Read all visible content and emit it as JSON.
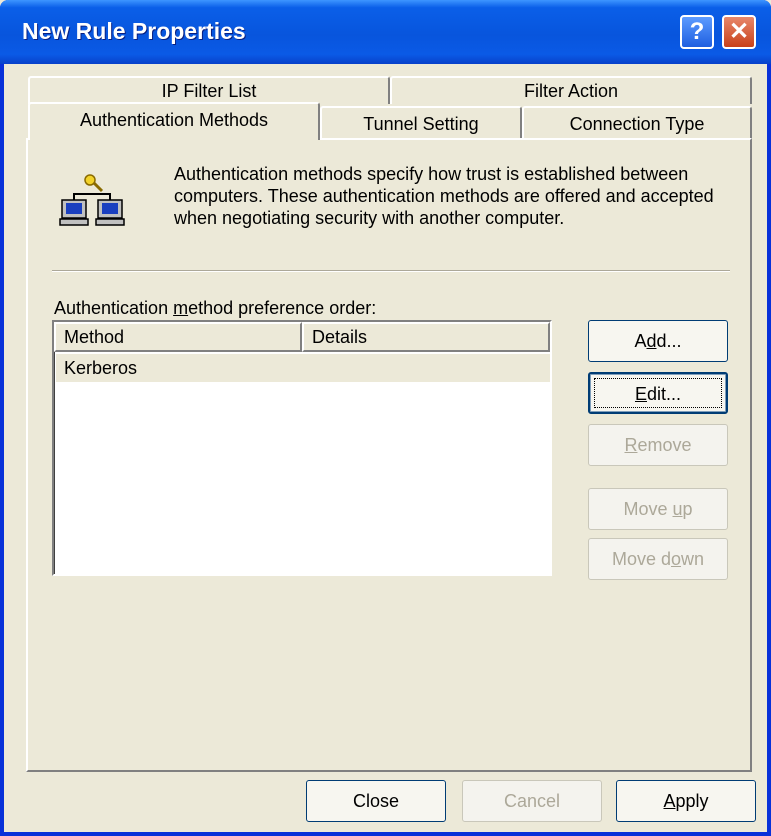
{
  "window": {
    "title": "New Rule Properties",
    "help_glyph": "?",
    "close_glyph": "✕"
  },
  "tabs": [
    {
      "label": "IP Filter List"
    },
    {
      "label": "Filter Action"
    },
    {
      "label": "Authentication Methods",
      "selected": true
    },
    {
      "label": "Tunnel Setting"
    },
    {
      "label": "Connection Type"
    }
  ],
  "panel": {
    "description": "Authentication methods specify how trust is established between computers. These authentication methods are offered and accepted when negotiating security with another computer.",
    "list_label_pre": "Authentication ",
    "list_label_mnemonic": "m",
    "list_label_post": "ethod preference order:",
    "columns": [
      "Method",
      "Details"
    ],
    "rows": [
      {
        "method": "Kerberos",
        "details": ""
      }
    ],
    "buttons": {
      "add_pre": "A",
      "add_mnemonic": "d",
      "add_post": "d...",
      "edit_mnemonic": "E",
      "edit_post": "dit...",
      "remove_mnemonic": "R",
      "remove_post": "emove",
      "moveup_pre": "Move ",
      "moveup_mnemonic": "u",
      "moveup_post": "p",
      "movedown_pre": "Move d",
      "movedown_mnemonic": "o",
      "movedown_post": "wn"
    }
  },
  "footer": {
    "close": "Close",
    "cancel": "Cancel",
    "apply_mnemonic": "A",
    "apply_post": "pply"
  },
  "colors": {
    "titlebar": "#0855dd",
    "face": "#ece9d8",
    "disabled_text": "#aca899"
  },
  "state": {
    "selected_tab": "Authentication Methods",
    "selected_row": "Kerberos",
    "disabled_buttons": [
      "Remove",
      "Move up",
      "Move down",
      "Cancel"
    ]
  }
}
